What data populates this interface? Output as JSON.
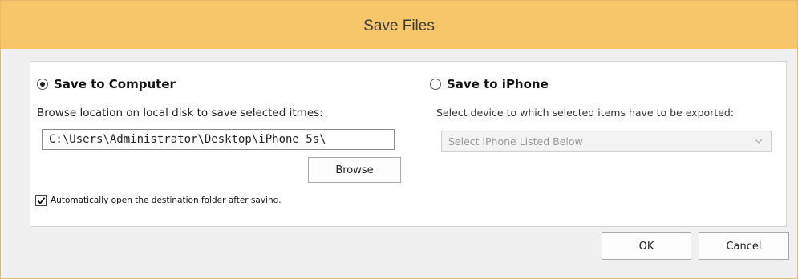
{
  "dialog": {
    "title": "Save Files"
  },
  "left": {
    "radio_label": "Save to Computer",
    "radio_checked": true,
    "browse_prompt": "Browse location on local disk to save selected itmes:",
    "path_value": "C:\\Users\\Administrator\\Desktop\\iPhone 5s\\",
    "browse_button": "Browse",
    "auto_open_label": "Automatically open the destination folder after saving.",
    "auto_open_checked": true
  },
  "right": {
    "radio_label": "Save to iPhone",
    "radio_checked": false,
    "device_prompt": "Select device to which selected items have to be exported:",
    "select_value": "Select iPhone Listed Below"
  },
  "footer": {
    "ok_label": "OK",
    "cancel_label": "Cancel"
  },
  "icons": {
    "dropdown": "chevron-down-icon",
    "check": "checkmark-icon"
  }
}
